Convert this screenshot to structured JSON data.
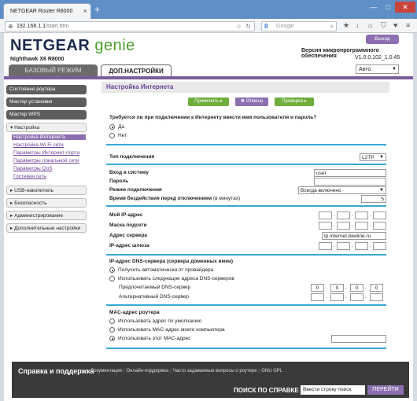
{
  "browser": {
    "tab_title": "NETGEAR Router R8000",
    "tab_close": "×",
    "new_tab": "+",
    "url_host": "192.168.1.1",
    "url_path": "/start.htm",
    "search_placeholder": "Google",
    "window_controls": {
      "minimize": "—",
      "maximize": "□",
      "close": "✕"
    }
  },
  "header": {
    "logo_main": "NETGEAR",
    "logo_genie": "genie",
    "model": "Nighthawk X6 R8000",
    "logout": "Выход",
    "firmware_title": "Версия микропрограммного обеспечения",
    "firmware_version": "V1.0.0.102_1.0.45",
    "language": "Авто"
  },
  "tabs": {
    "basic": "БАЗОВЫЙ РЕЖИМ",
    "advanced": "ДОП.НАСТРОЙКИ"
  },
  "sidebar": {
    "router_status": "Состояние роутера",
    "setup_wizard": "Мастер установки",
    "wps_wizard": "Мастер WPS",
    "setup": "▾ Настройка",
    "sub_items": [
      "Настройка Интернета",
      "Настройка Wi Fi сети",
      "Параметры Интернет-порта",
      "Параметры локальной сети",
      "Параметры QoS",
      "Гостевая сеть"
    ],
    "usb": "▸ USB-накопитель",
    "security": "▸ Безопасность",
    "admin": "▸ Администрирование",
    "advanced_setup": "▸ Дополнительные настройки"
  },
  "content": {
    "title": "Настройка Интернета",
    "apply": "Применить ▸",
    "cancel": "✖ Отмена",
    "test": "Проверка ▸",
    "login_question": "Требуется ли при подключении к Интернету ввести имя пользователя и пароль?",
    "yes": "Да",
    "no": "Нет",
    "conn_type_label": "Тип подключения",
    "conn_type_value": "L2TP",
    "login_label": "Вход в систему",
    "login_value": "user",
    "password_label": "Пароль",
    "mode_label": "Режим подключения",
    "mode_value": "Всегда включено",
    "idle_label": "Время бездействия перед отключением",
    "idle_unit": "(в минутах)",
    "idle_value": "5",
    "my_ip_label": "Мой IP-адрес",
    "subnet_label": "Маска подсети",
    "server_label": "Адрес сервера",
    "server_value": "tp.internet.beeline.ru",
    "gateway_label": "IP-адрес шлюза",
    "dns_title": "IP-адрес DNS-сервера (сервера доменных имен)",
    "dns_auto": "Получить автоматически от провайдера",
    "dns_manual": "Использовать следующие адреса DNS-серверов",
    "dns_primary": "Предпочитаемый DNS-сервер",
    "dns_primary_octets": [
      "0",
      "0",
      "0",
      "0"
    ],
    "dns_secondary": "Альтернативный DNS-сервер",
    "mac_title": "MAC-адрес роутера",
    "mac_default": "Использовать адрес по умолчанию",
    "mac_computer": "Использовать MAC-адрес моего компьютера",
    "mac_this": "Использовать этот MAC-адрес",
    "dot": "."
  },
  "footer": {
    "title": "Справка и поддержка",
    "links": [
      "Документация",
      "Онлайн-поддержка",
      "Часто задаваемые вопросы о роутере",
      "GNU GPL"
    ],
    "search_label": "ПОИСК ПО СПРАВКЕ",
    "search_value": "Ввести строку поиск",
    "search_button": "ПЕРЕЙТИ"
  }
}
